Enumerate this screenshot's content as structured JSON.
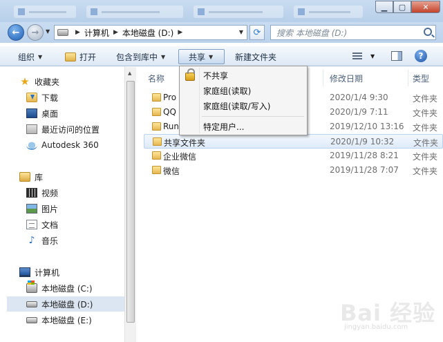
{
  "address": {
    "crumbs": [
      "计算机",
      "本地磁盘 (D:)"
    ],
    "search_placeholder": "搜索 本地磁盘 (D:)"
  },
  "toolbar": {
    "organize": "组织",
    "open": "打开",
    "include_in_library": "包含到库中",
    "share": "共享",
    "new_folder": "新建文件夹"
  },
  "sidebar": {
    "favorites": {
      "label": "收藏夹",
      "items": [
        {
          "label": "下载",
          "icon": "download-folder-icon"
        },
        {
          "label": "桌面",
          "icon": "desktop-icon"
        },
        {
          "label": "最近访问的位置",
          "icon": "recent-places-icon"
        },
        {
          "label": "Autodesk 360",
          "icon": "cloud-icon"
        }
      ]
    },
    "libraries": {
      "label": "库",
      "items": [
        {
          "label": "视频",
          "icon": "video-icon"
        },
        {
          "label": "图片",
          "icon": "pictures-icon"
        },
        {
          "label": "文档",
          "icon": "documents-icon"
        },
        {
          "label": "音乐",
          "icon": "music-icon"
        }
      ]
    },
    "computer": {
      "label": "计算机",
      "items": [
        {
          "label": "本地磁盘 (C:)",
          "icon": "system-drive-icon"
        },
        {
          "label": "本地磁盘 (D:)",
          "icon": "drive-icon",
          "selected": true
        },
        {
          "label": "本地磁盘 (E:)",
          "icon": "drive-icon"
        }
      ]
    }
  },
  "columns": {
    "name": "名称",
    "modified": "修改日期",
    "type": "类型"
  },
  "files": [
    {
      "name": "Pro",
      "modified": "2020/1/4 9:30",
      "type": "文件夹"
    },
    {
      "name": "QQ",
      "modified": "2020/1/9 7:11",
      "type": "文件夹"
    },
    {
      "name": "Run",
      "modified": "2019/12/10 13:16",
      "type": "文件夹"
    },
    {
      "name": "共享文件夹",
      "modified": "2020/1/9 10:32",
      "type": "文件夹"
    },
    {
      "name": "企业微信",
      "modified": "2019/11/28 8:21",
      "type": "文件夹"
    },
    {
      "name": "微信",
      "modified": "2019/11/28 7:07",
      "type": "文件夹"
    }
  ],
  "share_menu": {
    "items": [
      "不共享",
      "家庭组(读取)",
      "家庭组(读取/写入)",
      "特定用户..."
    ]
  },
  "watermark": {
    "logo": "Bai 经验",
    "url": "jingyan.baidu.com"
  }
}
